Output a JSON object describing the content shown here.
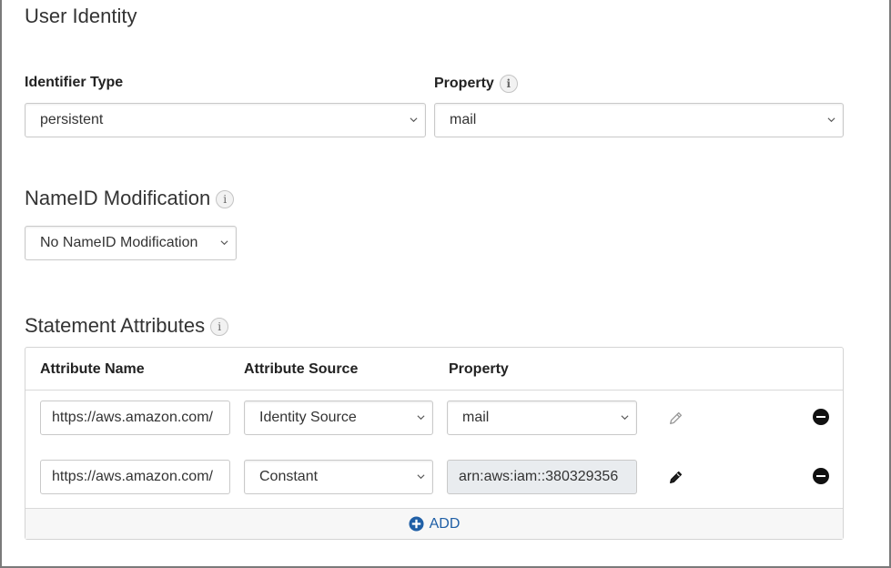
{
  "user_identity": {
    "title": "User Identity",
    "identifier_type": {
      "label": "Identifier Type",
      "value": "persistent"
    },
    "property": {
      "label": "Property",
      "value": "mail"
    }
  },
  "nameid": {
    "title": "NameID Modification",
    "value": "No NameID Modification"
  },
  "statement_attributes": {
    "title": "Statement Attributes",
    "columns": [
      "Attribute Name",
      "Attribute Source",
      "Property"
    ],
    "rows": [
      {
        "name": "https://aws.amazon.com/",
        "source": "Identity Source",
        "property": "mail"
      },
      {
        "name": "https://aws.amazon.com/",
        "source": "Constant",
        "property": "arn:aws:iam::380329356"
      }
    ],
    "add_label": "ADD"
  },
  "icons": {
    "info": "info-icon",
    "chevron": "chevron-down-icon",
    "edit": "pencil-icon",
    "remove": "minus-circle-icon",
    "add": "plus-circle-icon"
  },
  "colors": {
    "accent": "#1f5fa6"
  }
}
